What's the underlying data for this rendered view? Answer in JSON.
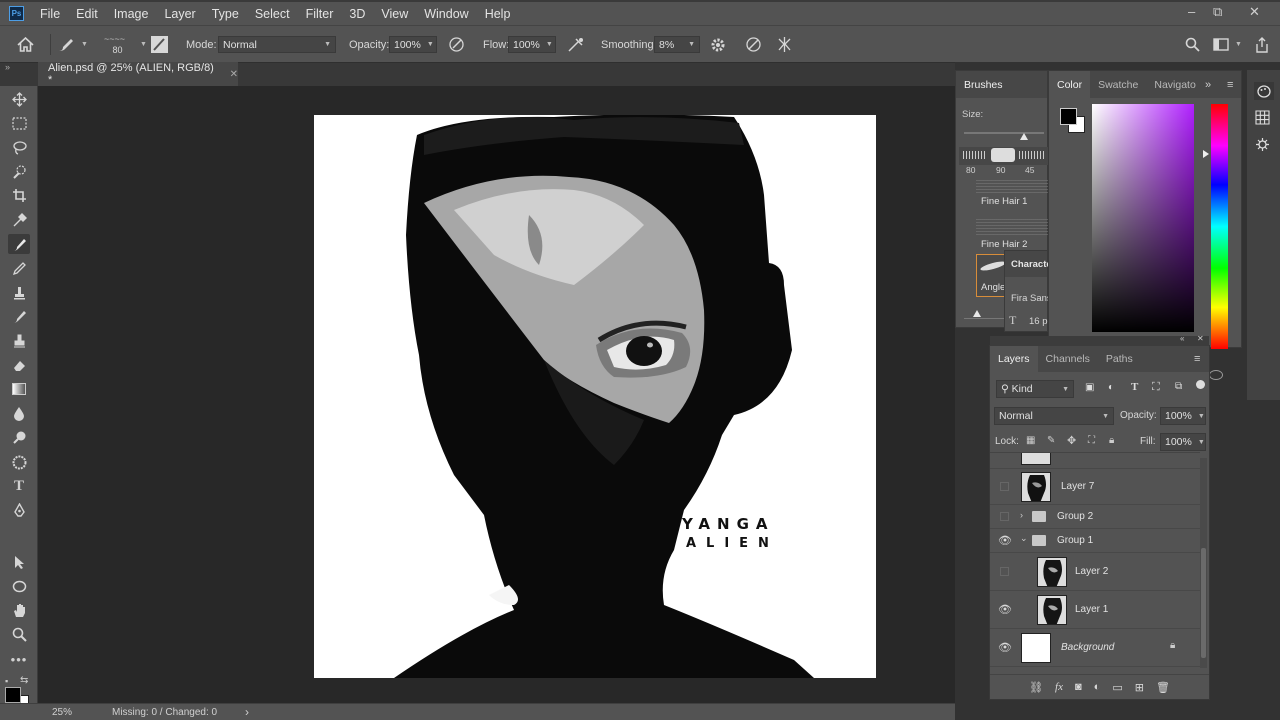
{
  "app": {
    "logo": "Ps"
  },
  "menu": [
    "File",
    "Edit",
    "Image",
    "Layer",
    "Type",
    "Select",
    "Filter",
    "3D",
    "View",
    "Window",
    "Help"
  ],
  "window_controls": {
    "minimize": "–",
    "restore": "⧉",
    "close": "✕"
  },
  "options": {
    "brush_size": "80",
    "mode_label": "Mode:",
    "mode_value": "Normal",
    "opacity_label": "Opacity:",
    "opacity_value": "100%",
    "flow_label": "Flow:",
    "flow_value": "100%",
    "smoothing_label": "Smoothing:",
    "smoothing_value": "8%"
  },
  "document": {
    "tab_title": "Alien.psd @ 25% (ALIEN, RGB/8) *",
    "close": "✕"
  },
  "artwork": {
    "line1": "YANGA",
    "line2": "ALIEN"
  },
  "status": {
    "zoom": "25%",
    "info": "Missing: 0 / Changed: 0",
    "arrow": "›"
  },
  "brushes": {
    "tab": "Brushes",
    "size_label": "Size:",
    "presets": [
      "80",
      "90",
      "45"
    ],
    "items": [
      "Fine Hair 1",
      "Fine Hair 2",
      "Angle"
    ]
  },
  "character": {
    "tab": "Characte",
    "font": "Fira Sans",
    "size": "16 p"
  },
  "color_panel": {
    "tabs": [
      "Color",
      "Swatche",
      "Navigato"
    ],
    "foreground": "#000000",
    "background": "#ffffff"
  },
  "layers_panel": {
    "tabs": [
      "Layers",
      "Channels",
      "Paths"
    ],
    "filter_kind": "Kind",
    "blend_mode": "Normal",
    "opacity_label": "Opacity:",
    "opacity_value": "100%",
    "lock_label": "Lock:",
    "fill_label": "Fill:",
    "fill_value": "100%",
    "layers": [
      {
        "name": "Layer 7",
        "visible": false
      },
      {
        "name": "Group 2",
        "visible": false
      },
      {
        "name": "Group 1",
        "visible": true
      },
      {
        "name": "Layer 2",
        "visible": false
      },
      {
        "name": "Layer 1",
        "visible": true
      },
      {
        "name": "Background",
        "visible": true
      }
    ],
    "footer_icons": [
      "link-icon",
      "fx-icon",
      "mask-icon",
      "adjustment-icon",
      "folder-icon",
      "new-layer-icon",
      "trash-icon"
    ]
  }
}
